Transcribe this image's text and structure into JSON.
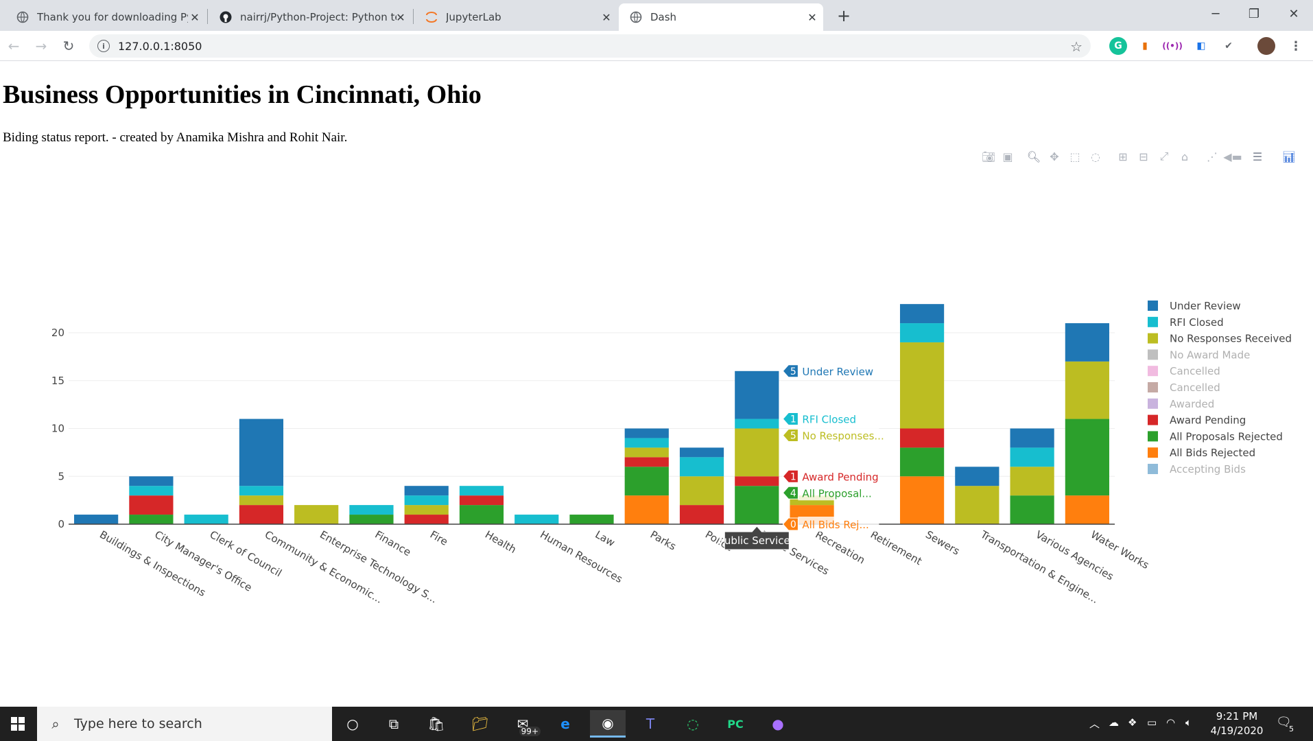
{
  "browser": {
    "tabs": [
      {
        "title": "Thank you for downloading PyCh",
        "active": false
      },
      {
        "title": "nairrj/Python-Project: Python tea",
        "active": false
      },
      {
        "title": "JupyterLab",
        "active": false
      },
      {
        "title": "Dash",
        "active": true
      }
    ],
    "url": "127.0.0.1:8050"
  },
  "page": {
    "title": "Business Opportunities in Cincinnati, Ohio",
    "subtitle": "Biding status report. - created by Anamika Mishra and Rohit Nair."
  },
  "modebar": [
    "camera-icon",
    "save-icon",
    "zoom-icon",
    "pan-icon",
    "box-select-icon",
    "lasso-icon",
    "zoom-in-icon",
    "zoom-out-icon",
    "autoscale-icon",
    "home-icon",
    "spike-lines-icon",
    "hover-closest-icon",
    "hover-compare-icon",
    "plotly-logo-icon"
  ],
  "chart_data": {
    "type": "bar",
    "barmode": "stack",
    "categories": [
      "Buildings & Inspections",
      "City Manager's Office",
      "Clerk of Council",
      "Community & Economic Development",
      "Enterprise Technology Solutions",
      "Finance",
      "Fire",
      "Health",
      "Human Resources",
      "Law",
      "Parks",
      "Police",
      "Public Services",
      "Recreation",
      "Retirement",
      "Sewers",
      "Transportation & Engineering",
      "Various Agencies",
      "Water Works"
    ],
    "tick_labels": [
      "Buildings & Inspections",
      "City Manager's Office",
      "Clerk of Council",
      "Community & Economic...",
      "Enterprise Technology S...",
      "Finance",
      "Fire",
      "Health",
      "Human Resources",
      "Law",
      "Parks",
      "Police",
      "Public Services",
      "Recreation",
      "Retirement",
      "Sewers",
      "Transportation & Engine...",
      "Various Agencies",
      "Water Works"
    ],
    "series": [
      {
        "name": "All Bids Rejected",
        "color": "#ff7f0e",
        "visible": true,
        "values": [
          0,
          0,
          0,
          0,
          0,
          0,
          0,
          0,
          0,
          0,
          3,
          0,
          0,
          2,
          0,
          5,
          0,
          0,
          3
        ]
      },
      {
        "name": "All Proposals Rejected",
        "color": "#2ca02c",
        "visible": true,
        "values": [
          0,
          1,
          0,
          0,
          0,
          1,
          0,
          2,
          0,
          1,
          3,
          0,
          4,
          0,
          0,
          3,
          0,
          3,
          8
        ]
      },
      {
        "name": "Award Pending",
        "color": "#d62728",
        "visible": true,
        "values": [
          0,
          2,
          0,
          2,
          0,
          0,
          1,
          1,
          0,
          0,
          1,
          2,
          1,
          0,
          0,
          2,
          0,
          0,
          0
        ]
      },
      {
        "name": "Awarded",
        "color": "#9467bd",
        "visible": "legendonly",
        "values": []
      },
      {
        "name": "Cancelled",
        "color": "#8c564b",
        "visible": "legendonly",
        "values": []
      },
      {
        "name": "Cancelled",
        "color": "#e377c2",
        "visible": "legendonly",
        "values": []
      },
      {
        "name": "No Award Made",
        "color": "#7f7f7f",
        "visible": "legendonly",
        "values": []
      },
      {
        "name": "No Responses Received",
        "color": "#bcbd22",
        "visible": true,
        "values": [
          0,
          0,
          0,
          1,
          2,
          0,
          1,
          0,
          0,
          0,
          1,
          3,
          5,
          1,
          0,
          9,
          4,
          3,
          6
        ]
      },
      {
        "name": "RFI Closed",
        "color": "#17becf",
        "visible": true,
        "values": [
          0,
          1,
          1,
          1,
          0,
          1,
          1,
          1,
          1,
          0,
          1,
          2,
          1,
          0,
          0,
          2,
          0,
          2,
          0
        ]
      },
      {
        "name": "Under Review",
        "color": "#1f77b4",
        "visible": true,
        "values": [
          1,
          1,
          0,
          7,
          0,
          0,
          1,
          0,
          0,
          0,
          1,
          1,
          5,
          0,
          0,
          2,
          2,
          2,
          4
        ]
      }
    ],
    "legend": {
      "position": "right",
      "items": [
        {
          "name": "Under Review",
          "color": "#1f77b4",
          "visible": true
        },
        {
          "name": "RFI Closed",
          "color": "#17becf",
          "visible": true
        },
        {
          "name": "No Responses Received",
          "color": "#bcbd22",
          "visible": true
        },
        {
          "name": "No Award Made",
          "color": "#7f7f7f",
          "visible": false
        },
        {
          "name": "Cancelled",
          "color": "#e377c2",
          "visible": false
        },
        {
          "name": "Cancelled",
          "color": "#8c564b",
          "visible": false
        },
        {
          "name": "Awarded",
          "color": "#9467bd",
          "visible": false
        },
        {
          "name": "Award Pending",
          "color": "#d62728",
          "visible": true
        },
        {
          "name": "All Proposals Rejected",
          "color": "#2ca02c",
          "visible": true
        },
        {
          "name": "All Bids Rejected",
          "color": "#ff7f0e",
          "visible": true
        },
        {
          "name": "Accepting Bids",
          "color": "#1f77b4",
          "visible": false
        }
      ]
    },
    "ylim": [
      0,
      24
    ],
    "yticks": [
      0,
      5,
      10,
      15,
      20
    ],
    "grid": true,
    "hover": {
      "category": "Public Services",
      "category_label": "Public Services",
      "labels": [
        {
          "series": "Under Review",
          "value": 5,
          "text": "Under Review",
          "color": "#1f77b4"
        },
        {
          "series": "RFI Closed",
          "value": 1,
          "text": "RFI Closed",
          "color": "#17becf"
        },
        {
          "series": "No Responses Received",
          "value": 5,
          "text": "No Responses...",
          "color": "#bcbd22"
        },
        {
          "series": "Award Pending",
          "value": 1,
          "text": "Award Pending",
          "color": "#d62728"
        },
        {
          "series": "All Proposals Rejected",
          "value": 4,
          "text": "All Proposal...",
          "color": "#2ca02c"
        },
        {
          "series": "All Bids Rejected",
          "value": 0,
          "text": "All Bids Rej...",
          "color": "#ff7f0e"
        }
      ]
    }
  },
  "taskbar": {
    "search_placeholder": "Type here to search",
    "time": "9:21 PM",
    "date": "4/19/2020",
    "mail_badge": "99+",
    "notification_count": "5"
  }
}
